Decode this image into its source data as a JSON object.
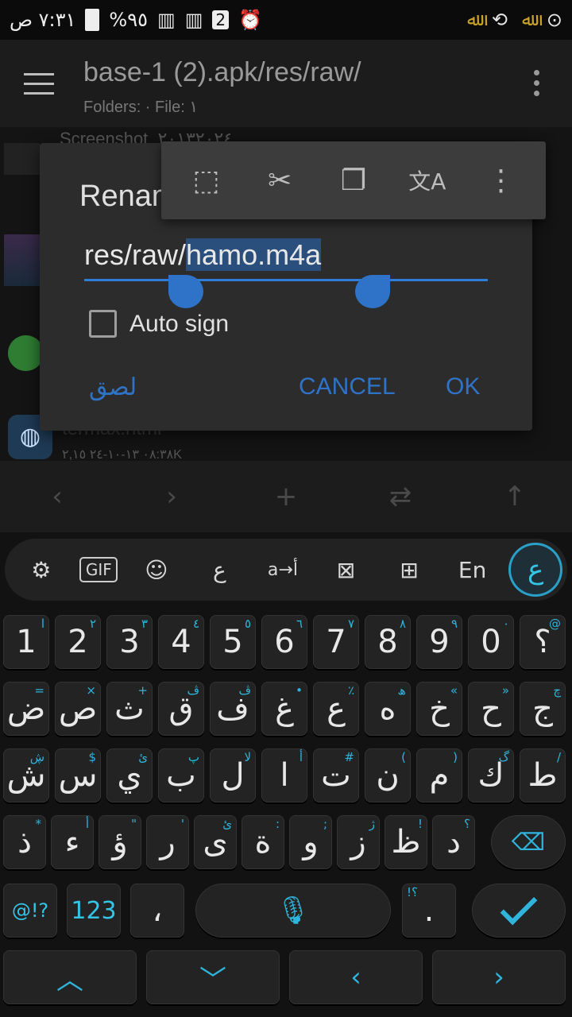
{
  "status_bar": {
    "time": "٧:٣١ ص",
    "battery": "%٩٥",
    "sim_badge": "2",
    "right_icons": [
      "alarm-icon",
      "signal-icon",
      "signal-icon",
      "battery-icon"
    ],
    "left_icons": [
      "screen-record-icon",
      "gold-calligraphy-icon",
      "share-icon",
      "gold-calligraphy-icon"
    ]
  },
  "app_bar": {
    "title": "base-1 (2).apk/res/raw/",
    "subtitle": "Folders: ·  File: ١"
  },
  "background_list": {
    "item1_name": "Screenshot_٢٠١٣٢٠٢٤",
    "file_name": "termax.html",
    "file_meta": "٠٨:٣٨ ١٣-١٠-٢٤  ٢,١٥K"
  },
  "bottom_nav": {
    "back": "‹",
    "forward": "›",
    "add": "+",
    "swap": "⇄",
    "up": "↑"
  },
  "dialog": {
    "title": "Renam",
    "path_prefix": "res/raw/",
    "selected_name": "hamo.m4a",
    "checkbox_label": "Auto sign",
    "checkbox_checked": false,
    "paste_label": "لصق",
    "cancel_label": "CANCEL",
    "ok_label": "OK",
    "accent_color": "#2f73c9"
  },
  "selection_toolbar": {
    "items": [
      "select-all-icon",
      "cut-icon",
      "copy-icon",
      "translate-icon",
      "more-vert-icon"
    ],
    "glyphs": [
      "⬚",
      "✂",
      "❐",
      "文A",
      "⋮"
    ]
  },
  "keyboard": {
    "toolbar": [
      "⚙",
      "GIF",
      "☺",
      "ع",
      "a→أ",
      "⊠",
      "⊞",
      "En",
      "ع"
    ],
    "number_row": [
      {
        "label": "1",
        "hint": "ا"
      },
      {
        "label": "2",
        "hint": "٢"
      },
      {
        "label": "3",
        "hint": "٣"
      },
      {
        "label": "4",
        "hint": "٤"
      },
      {
        "label": "5",
        "hint": "٥"
      },
      {
        "label": "6",
        "hint": "٦"
      },
      {
        "label": "7",
        "hint": "٧"
      },
      {
        "label": "8",
        "hint": "٨"
      },
      {
        "label": "9",
        "hint": "٩"
      },
      {
        "label": "0",
        "hint": "٠"
      },
      {
        "label": "؟",
        "hint": "@"
      }
    ],
    "row1": [
      {
        "label": "ض",
        "hint": "="
      },
      {
        "label": "ص",
        "hint": "×"
      },
      {
        "label": "ث",
        "hint": "+"
      },
      {
        "label": "ق",
        "hint": "ڤ"
      },
      {
        "label": "ف",
        "hint": "ڤ"
      },
      {
        "label": "غ",
        "hint": "•"
      },
      {
        "label": "ع",
        "hint": "٪"
      },
      {
        "label": "ه",
        "hint": "ھ"
      },
      {
        "label": "خ",
        "hint": "«"
      },
      {
        "label": "ح",
        "hint": "»"
      },
      {
        "label": "ج",
        "hint": "چ"
      }
    ],
    "row2": [
      {
        "label": "ش",
        "hint": "ڜ"
      },
      {
        "label": "س",
        "hint": "$"
      },
      {
        "label": "ي",
        "hint": "ئ"
      },
      {
        "label": "ب",
        "hint": "پ"
      },
      {
        "label": "ل",
        "hint": "لا"
      },
      {
        "label": "ا",
        "hint": "أ"
      },
      {
        "label": "ت",
        "hint": "#"
      },
      {
        "label": "ن",
        "hint": "("
      },
      {
        "label": "م",
        "hint": ")"
      },
      {
        "label": "ك",
        "hint": "گ"
      },
      {
        "label": "ط",
        "hint": "/"
      }
    ],
    "row3": [
      {
        "label": "ذ",
        "hint": "*"
      },
      {
        "label": "ء",
        "hint": "أ"
      },
      {
        "label": "ؤ",
        "hint": "\""
      },
      {
        "label": "ر",
        "hint": "'"
      },
      {
        "label": "ى",
        "hint": "ئ"
      },
      {
        "label": "ة",
        "hint": ":"
      },
      {
        "label": "و",
        "hint": ";"
      },
      {
        "label": "ز",
        "hint": "ژ"
      },
      {
        "label": "ظ",
        "hint": "!"
      },
      {
        "label": "د",
        "hint": "؟"
      }
    ],
    "bottom_row": {
      "symbols": "@!?",
      "numbers": "123",
      "comma": "،",
      "period": ".",
      "period_hint": "!؟"
    },
    "arrow_keys": [
      "‹",
      "›",
      "‹",
      "›"
    ],
    "accent_color": "#2fb4dc"
  }
}
